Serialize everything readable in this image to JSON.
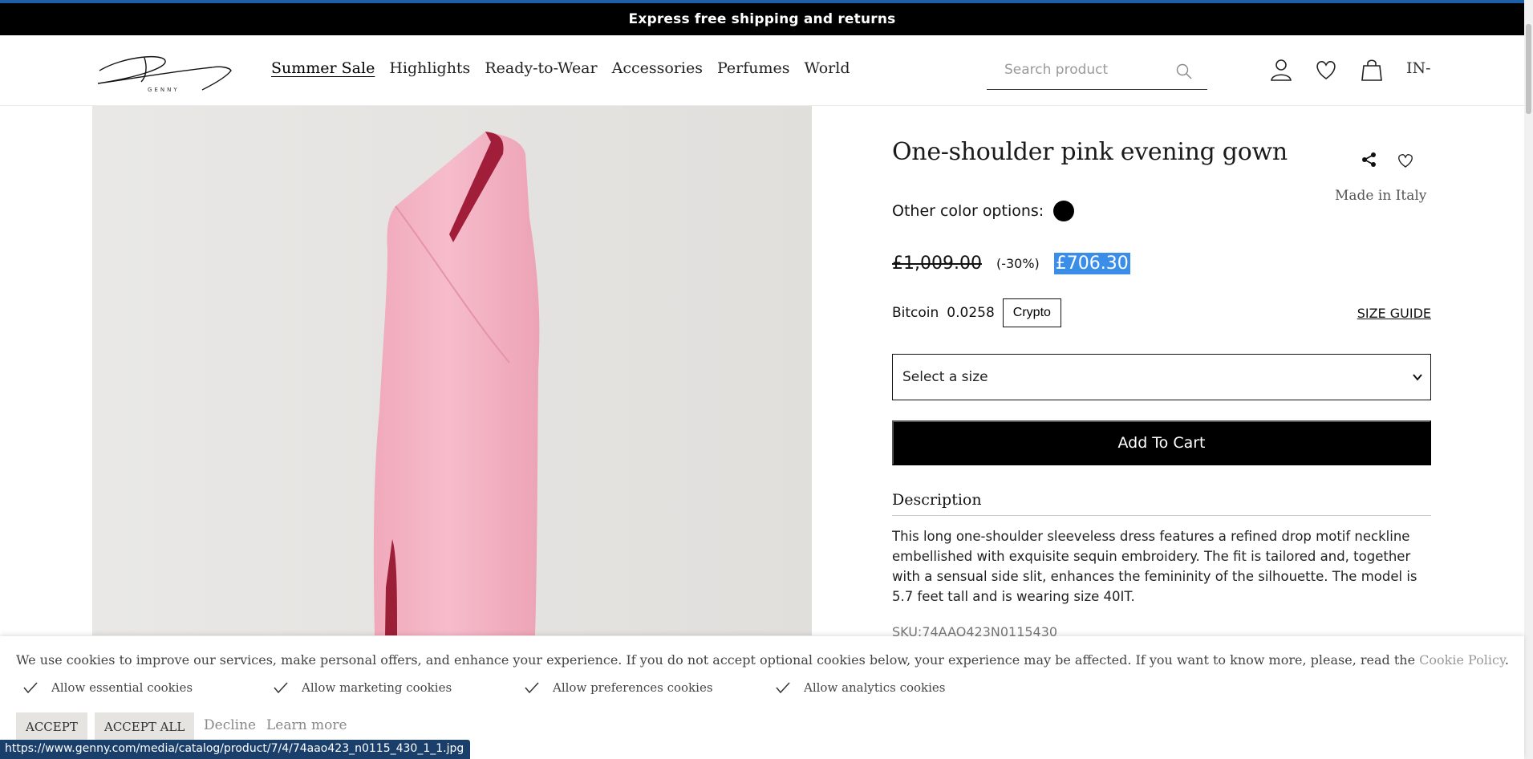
{
  "promo": {
    "text": "Express free shipping and returns"
  },
  "header": {
    "logo_text": "GENNY",
    "nav": [
      {
        "label": "Summer Sale",
        "active": true
      },
      {
        "label": "Highlights"
      },
      {
        "label": "Ready-to-Wear"
      },
      {
        "label": "Accessories"
      },
      {
        "label": "Perfumes"
      },
      {
        "label": "World"
      }
    ],
    "search_placeholder": "Search product",
    "icons": [
      "account-icon",
      "wishlist-heart-icon",
      "shopping-bag-icon"
    ],
    "language": "IN-"
  },
  "product": {
    "title": "One-shoulder pink evening gown",
    "made_in": "Made in Italy",
    "color_options_label": "Other color options:",
    "color_swatch": "#000000",
    "dress_color": "#f4b6c6",
    "old_price": "£1,009.00",
    "discount": "(-30%)",
    "new_price": "£706.30",
    "bitcoin_label": "Bitcoin",
    "bitcoin_amount": "0.0258",
    "crypto_button": "Crypto",
    "size_guide": "SIZE GUIDE",
    "size_select": "Select a size",
    "add_to_cart": "Add To Cart",
    "description_heading": "Description",
    "description": "This long one-shoulder sleeveless dress features a refined drop motif neckline embellished with exquisite sequin embroidery. The fit is tailored and, together with a sensual side slit, enhances the femininity of the silhouette. The model is 5.7 feet tall and is wearing size 40IT.",
    "sku": "SKU:74AAO423N0115430"
  },
  "cookie": {
    "text": "We use cookies to improve our services, make personal offers, and enhance your experience. If you do not accept optional cookies below, your experience may be affected. If you want to know more, please, read the",
    "policy_link": "Cookie Policy",
    "policy_suffix": ".",
    "options": [
      "Allow essential cookies",
      "Allow marketing cookies",
      "Allow preferences cookies",
      "Allow analytics cookies"
    ],
    "accept": "ACCEPT",
    "accept_all": "ACCEPT ALL",
    "decline": "Decline",
    "learn_more": "Learn more"
  },
  "statusbar": {
    "url": "https://www.genny.com/media/catalog/product/7/4/74aao423_n0115_430_1_1.jpg"
  }
}
